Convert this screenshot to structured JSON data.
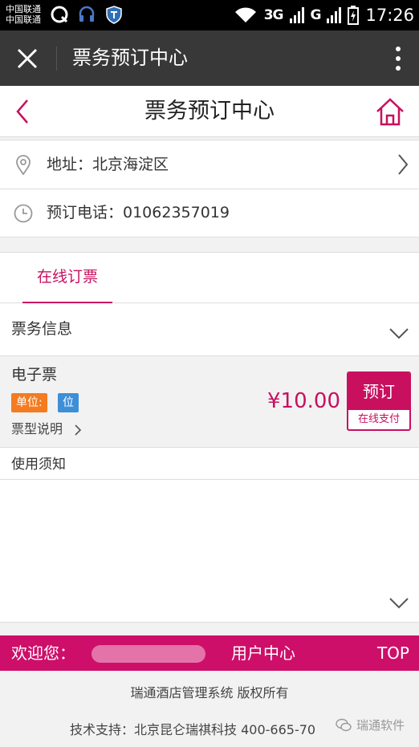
{
  "statusbar": {
    "carrier_1": "中国联通",
    "carrier_2": "中国联通",
    "network_1": "3G",
    "network_2": "G",
    "time": "17:26"
  },
  "titlebar": {
    "title": "票务预订中心"
  },
  "header": {
    "title": "票务预订中心"
  },
  "address": {
    "text": "地址：北京海淀区"
  },
  "phone": {
    "text": "预订电话：01062357019"
  },
  "tabs": [
    {
      "label": "在线订票",
      "active": true
    }
  ],
  "ticket_info": {
    "label": "票务信息"
  },
  "ticket": {
    "name": "电子票",
    "unit_badge": "单位:",
    "unit_value": "位",
    "description_link": "票型说明",
    "price": "¥10.00",
    "book_label": "预订",
    "payment_label": "在线支付"
  },
  "notice": {
    "label": "使用须知"
  },
  "footer_bar": {
    "welcome": "欢迎您：",
    "user_center": "用户中心",
    "top": "TOP"
  },
  "footer": {
    "copyright": "瑞通酒店管理系统 版权所有",
    "support": "技术支持：北京昆仑瑞祺科技 400-665-70",
    "watermark": "瑞通软件"
  },
  "colors": {
    "accent": "#c8105f",
    "footer_bar": "#cd0f6a",
    "titlebar": "#383838",
    "badge_orange": "#f47b20",
    "badge_blue": "#3d8fd8"
  }
}
